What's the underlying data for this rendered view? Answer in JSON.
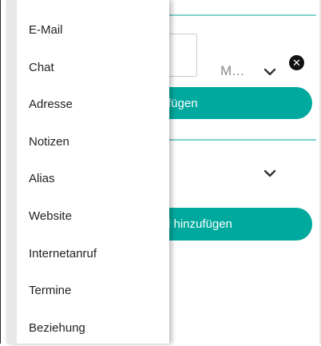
{
  "background_form": {
    "field_value_text": "M...",
    "button_1_label": "fügen",
    "button_2_label": "l hinzufügen",
    "accent_color": "#00a99d"
  },
  "menu": {
    "items": [
      {
        "label": "E-Mail"
      },
      {
        "label": "Chat"
      },
      {
        "label": "Adresse"
      },
      {
        "label": "Notizen"
      },
      {
        "label": "Alias"
      },
      {
        "label": "Website"
      },
      {
        "label": "Internetanruf"
      },
      {
        "label": "Termine"
      },
      {
        "label": "Beziehung"
      }
    ]
  },
  "icons": {
    "close": "close-icon",
    "expand": "chevron-down-icon"
  }
}
